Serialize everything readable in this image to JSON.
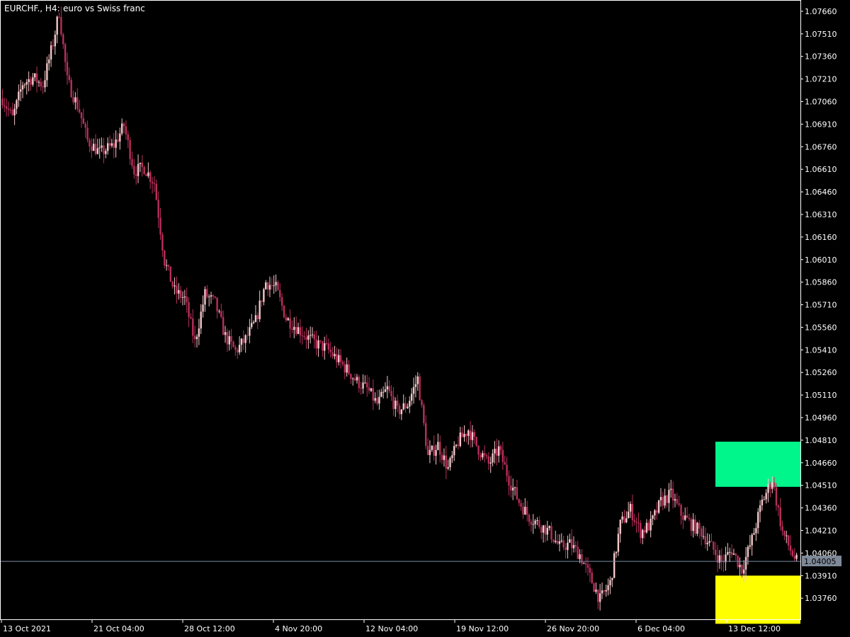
{
  "header": {
    "symbol_timeframe": "EURCHF., H4:",
    "description": "euro vs Swiss franc"
  },
  "current_price_label": "1.04005",
  "colors": {
    "background": "#000000",
    "frame": "#ffffff",
    "bull_candle": "#f4c7c9",
    "bear_candle": "#b8305a",
    "price_line": "#7a8ba6",
    "price_tag_bg": "#7f8a99",
    "supply_zone": "#00f58a",
    "demand_zone": "#ffff00",
    "text": "#ffffff"
  },
  "chart_data": {
    "type": "candlestick",
    "ylim": [
      1.03615,
      1.07735
    ],
    "y_ticks": [
      "1.07660",
      "1.07510",
      "1.07360",
      "1.07210",
      "1.07060",
      "1.06910",
      "1.06760",
      "1.06610",
      "1.06460",
      "1.06310",
      "1.06160",
      "1.06010",
      "1.05860",
      "1.05710",
      "1.05560",
      "1.05410",
      "1.05260",
      "1.05110",
      "1.04960",
      "1.04810",
      "1.04660",
      "1.04510",
      "1.04360",
      "1.04210",
      "1.04060",
      "1.03910",
      "1.03760"
    ],
    "x_ticks": [
      "13 Oct 2021",
      "21 Oct 04:00",
      "28 Oct 12:00",
      "4 Nov 20:00",
      "12 Nov 04:00",
      "19 Nov 12:00",
      "26 Nov 20:00",
      "6 Dec 04:00",
      "13 Dec 12:00"
    ],
    "current_price": 1.04005,
    "zones": [
      {
        "name": "supply",
        "top": 1.048,
        "bottom": 1.045
      },
      {
        "name": "demand",
        "top": 1.0391,
        "bottom": 1.0359
      }
    ],
    "close_path": [
      [
        0,
        1.0708
      ],
      [
        5,
        1.0695
      ],
      [
        10,
        1.0718
      ],
      [
        15,
        1.0722
      ],
      [
        20,
        1.0717
      ],
      [
        25,
        1.0745
      ],
      [
        28,
        1.0766
      ],
      [
        32,
        1.072
      ],
      [
        38,
        1.07
      ],
      [
        42,
        1.068
      ],
      [
        48,
        1.0672
      ],
      [
        55,
        1.0677
      ],
      [
        60,
        1.069
      ],
      [
        65,
        1.066
      ],
      [
        70,
        1.0662
      ],
      [
        75,
        1.0652
      ],
      [
        80,
        1.06
      ],
      [
        85,
        1.058
      ],
      [
        90,
        1.0575
      ],
      [
        95,
        1.0546
      ],
      [
        100,
        1.0578
      ],
      [
        105,
        1.0572
      ],
      [
        110,
        1.055
      ],
      [
        115,
        1.054
      ],
      [
        120,
        1.0548
      ],
      [
        125,
        1.056
      ],
      [
        130,
        1.0586
      ],
      [
        135,
        1.0582
      ],
      [
        140,
        1.0562
      ],
      [
        145,
        1.0556
      ],
      [
        150,
        1.055
      ],
      [
        155,
        1.0545
      ],
      [
        160,
        1.0542
      ],
      [
        165,
        1.0535
      ],
      [
        170,
        1.0528
      ],
      [
        175,
        1.052
      ],
      [
        180,
        1.0515
      ],
      [
        185,
        1.0505
      ],
      [
        190,
        1.0515
      ],
      [
        195,
        1.05
      ],
      [
        200,
        1.0505
      ],
      [
        205,
        1.0522
      ],
      [
        210,
        1.047
      ],
      [
        215,
        1.0478
      ],
      [
        220,
        1.0462
      ],
      [
        225,
        1.048
      ],
      [
        230,
        1.0488
      ],
      [
        235,
        1.0475
      ],
      [
        240,
        1.0465
      ],
      [
        245,
        1.0475
      ],
      [
        250,
        1.0455
      ],
      [
        255,
        1.044
      ],
      [
        260,
        1.043
      ],
      [
        265,
        1.0425
      ],
      [
        270,
        1.042
      ],
      [
        275,
        1.041
      ],
      [
        280,
        1.0412
      ],
      [
        285,
        1.0405
      ],
      [
        290,
        1.039
      ],
      [
        295,
        1.0375
      ],
      [
        300,
        1.0386
      ],
      [
        305,
        1.0425
      ],
      [
        310,
        1.0435
      ],
      [
        315,
        1.042
      ],
      [
        320,
        1.0425
      ],
      [
        325,
        1.044
      ],
      [
        330,
        1.0445
      ],
      [
        335,
        1.0432
      ],
      [
        340,
        1.0425
      ],
      [
        345,
        1.042
      ],
      [
        350,
        1.041
      ],
      [
        355,
        1.04
      ],
      [
        360,
        1.0408
      ],
      [
        365,
        1.0395
      ],
      [
        370,
        1.0415
      ],
      [
        375,
        1.044
      ],
      [
        380,
        1.0455
      ],
      [
        385,
        1.042
      ],
      [
        390,
        1.0405
      ],
      [
        392,
        1.04005
      ]
    ],
    "bars_count": 393
  }
}
